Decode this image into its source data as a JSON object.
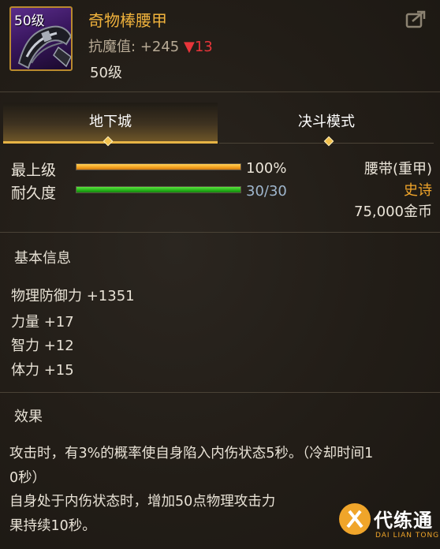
{
  "item": {
    "icon_level": "50级",
    "name": "奇物棒腰甲",
    "resistance_label": "抗魔值:",
    "resistance_value": "+245",
    "resistance_delta_arrow": "▼",
    "resistance_delta": "13",
    "level": "50级"
  },
  "tabs": [
    {
      "label": "地下城",
      "active": true
    },
    {
      "label": "决斗模式",
      "active": false
    }
  ],
  "stats": {
    "max_level": {
      "label": "最上级",
      "value": "100%",
      "fill": 1.0
    },
    "durability": {
      "label": "耐久度",
      "value": "30/30",
      "fill": 1.0
    }
  },
  "info": {
    "type": "腰带(重甲)",
    "rarity": "史诗",
    "price": "75,000金币"
  },
  "basic_info": {
    "title": "基本信息",
    "attributes": [
      "物理防御力 +1351",
      "力量 +17",
      "智力 +12",
      "体力 +15"
    ]
  },
  "effect": {
    "title": "效果",
    "lines": [
      "攻击时，有3%的概率使自身陷入内伤状态5秒。（冷却时间1",
      "0秒）",
      "自身处于内伤状态时，增加50点物理攻击力",
      "果持续10秒。"
    ]
  },
  "watermark": {
    "text": "代练通",
    "sub": "DAI LIAN TONG"
  },
  "colors": {
    "accent_gold": "#f0b23c",
    "rarity_orange": "#f0a52a",
    "negative_red": "#e8353a"
  }
}
